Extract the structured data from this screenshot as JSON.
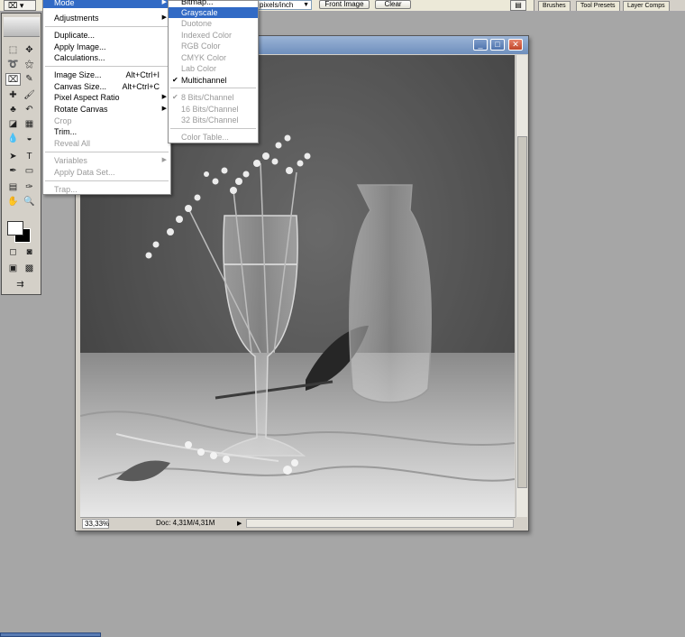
{
  "options_bar": {
    "tool_button": "⌧ ▾",
    "resolution_unit": "pixels/inch",
    "front_image_button": "Front Image",
    "clear_button": "Clear",
    "palette_tabs": [
      "Brushes",
      "Tool Presets",
      "Layer Comps"
    ]
  },
  "image_menu": {
    "items": [
      {
        "label": "Mode",
        "submenu": true,
        "highlighted": true
      },
      {
        "label": "Adjustments",
        "submenu": true
      },
      {
        "label": "Duplicate..."
      },
      {
        "label": "Apply Image..."
      },
      {
        "label": "Calculations..."
      },
      {
        "label": "Image Size...",
        "shortcut": "Alt+Ctrl+I"
      },
      {
        "label": "Canvas Size...",
        "shortcut": "Alt+Ctrl+C"
      },
      {
        "label": "Pixel Aspect Ratio",
        "submenu": true
      },
      {
        "label": "Rotate Canvas",
        "submenu": true
      },
      {
        "label": "Crop",
        "disabled": true
      },
      {
        "label": "Trim..."
      },
      {
        "label": "Reveal All",
        "disabled": true
      },
      {
        "label": "Variables",
        "submenu": true,
        "disabled": true
      },
      {
        "label": "Apply Data Set...",
        "disabled": true
      },
      {
        "label": "Trap...",
        "disabled": true
      }
    ]
  },
  "mode_submenu": {
    "items": [
      {
        "label": "Bitmap..."
      },
      {
        "label": "Grayscale",
        "highlighted": true
      },
      {
        "label": "Duotone",
        "disabled": true
      },
      {
        "label": "Indexed Color",
        "disabled": true
      },
      {
        "label": "RGB Color",
        "disabled": true
      },
      {
        "label": "CMYK Color",
        "disabled": true
      },
      {
        "label": "Lab Color",
        "disabled": true
      },
      {
        "label": "Multichannel",
        "checked": true
      },
      {
        "label": "8 Bits/Channel",
        "checked": true,
        "disabled": true
      },
      {
        "label": "16 Bits/Channel",
        "disabled": true
      },
      {
        "label": "32 Bits/Channel",
        "disabled": true
      },
      {
        "label": "Color Table...",
        "disabled": true
      }
    ]
  },
  "document": {
    "zoom": "33,33%",
    "doc_size": "Doc: 4,31M/4,31M",
    "window_buttons": [
      "_",
      "□",
      "✕"
    ]
  },
  "colors": {
    "menu_highlight": "#316ac5",
    "title_bar": "#6f8fbd",
    "workspace": "#a6a6a6"
  }
}
